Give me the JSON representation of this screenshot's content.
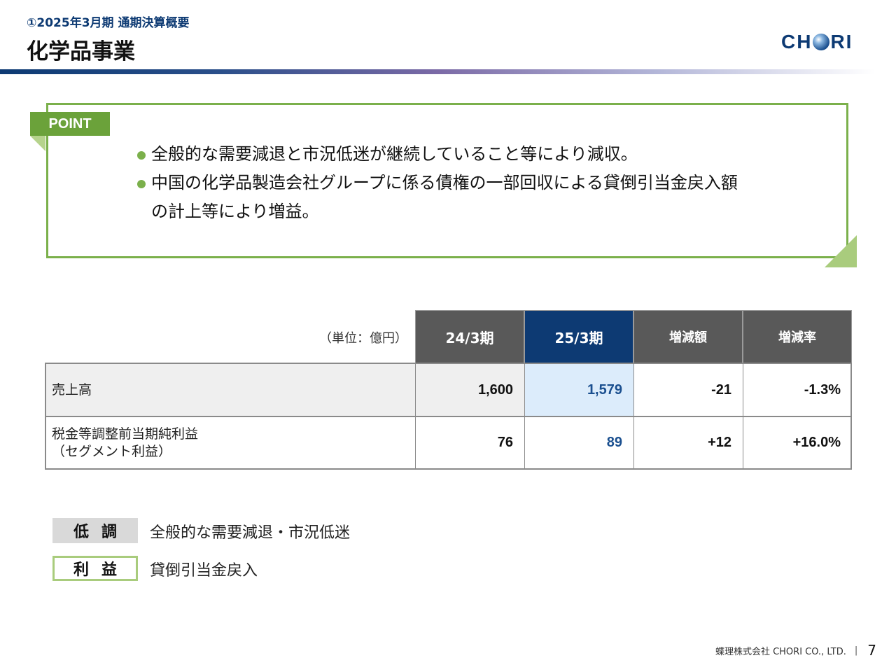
{
  "header": {
    "subtitle": "①2025年3月期 通期決算概要",
    "title": "化学品事業",
    "logo_text_left": "CH",
    "logo_text_right": "RI"
  },
  "point": {
    "tag": "POINT",
    "bullets": [
      "全般的な需要減退と市況低迷が継続していること等により減収。",
      "中国の化学品製造会社グループに係る債権の一部回収による貸倒引当金戻入額"
    ],
    "bullet2_cont": "の計上等により増益。"
  },
  "table": {
    "unit": "（単位：億円）",
    "headers": [
      "24/3期",
      "25/3期",
      "増減額",
      "増減率"
    ],
    "rows": [
      {
        "label": "売上高",
        "label2": "",
        "values": [
          "1,600",
          "1,579",
          "-21",
          "-1.3%"
        ]
      },
      {
        "label": "税金等調整前当期純利益",
        "label2": "（セグメント利益）",
        "values": [
          "76",
          "89",
          "+12",
          "+16.0%"
        ]
      }
    ]
  },
  "factors": [
    {
      "badge": "低調",
      "text": "全般的な需要減退・市況低迷"
    },
    {
      "badge": "利益",
      "text": "貸倒引当金戻入"
    }
  ],
  "footer": {
    "company": "蝶理株式会社 CHORI CO., LTD.",
    "separator": "|",
    "page": "7"
  },
  "colors": {
    "navy": "#0d3a73",
    "green": "#7bb04b",
    "header_gray": "#595959",
    "highlight": "#dcecfb"
  }
}
